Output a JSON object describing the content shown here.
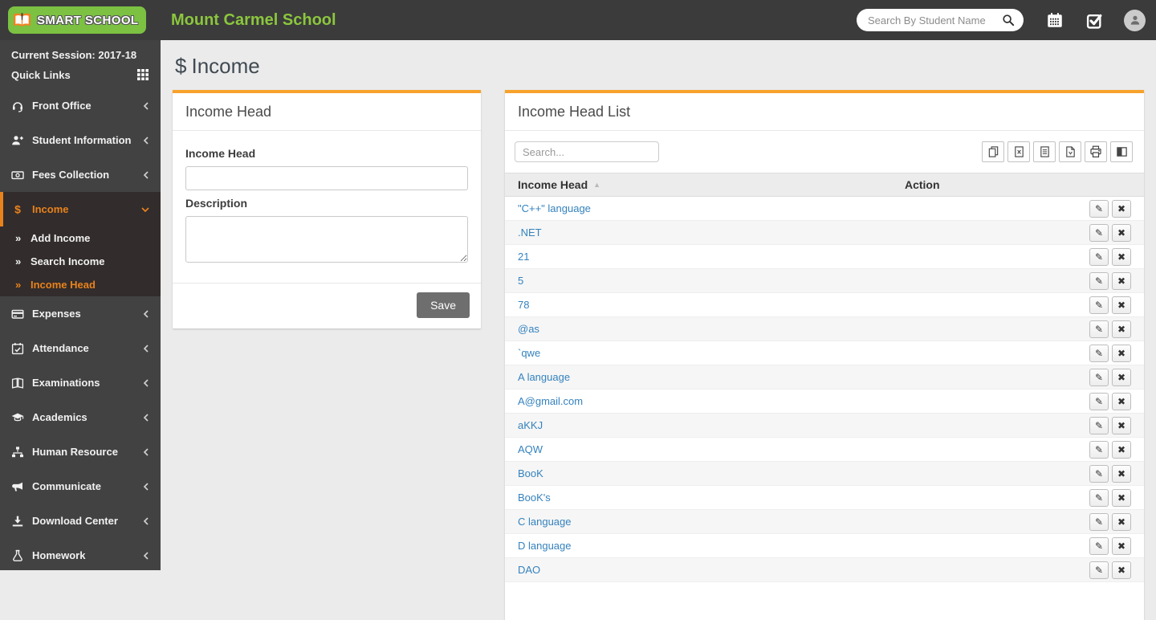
{
  "header": {
    "logo_text": "SMART SCHOOL",
    "school_name": "Mount Carmel School",
    "search_placeholder": "Search By Student Name"
  },
  "sidebar": {
    "session_label": "Current Session: 2017-18",
    "quick_links_label": "Quick Links",
    "items": [
      {
        "label": "Front Office",
        "icon": "headset-icon"
      },
      {
        "label": "Student Information",
        "icon": "user-plus-icon"
      },
      {
        "label": "Fees Collection",
        "icon": "money-bill-icon"
      },
      {
        "label": "Income",
        "icon": "dollar-icon",
        "active": true,
        "expanded": true,
        "children": [
          "Add Income",
          "Search Income",
          "Income Head"
        ],
        "active_child": "Income Head"
      },
      {
        "label": "Expenses",
        "icon": "credit-card-icon"
      },
      {
        "label": "Attendance",
        "icon": "calendar-check-icon"
      },
      {
        "label": "Examinations",
        "icon": "open-book-icon"
      },
      {
        "label": "Academics",
        "icon": "graduation-cap-icon"
      },
      {
        "label": "Human Resource",
        "icon": "sitemap-icon"
      },
      {
        "label": "Communicate",
        "icon": "bullhorn-icon"
      },
      {
        "label": "Download Center",
        "icon": "download-icon"
      },
      {
        "label": "Homework",
        "icon": "flask-icon"
      }
    ]
  },
  "page": {
    "title_icon": "$",
    "title": "Income"
  },
  "form_card": {
    "title": "Income Head",
    "income_head_label": "Income Head",
    "income_head_value": "",
    "description_label": "Description",
    "description_value": "",
    "save_label": "Save"
  },
  "list_card": {
    "title": "Income Head List",
    "search_placeholder": "Search...",
    "toolbar": [
      "copy",
      "excel",
      "csv",
      "pdf",
      "print",
      "columns"
    ],
    "table": {
      "columns": [
        "Income Head",
        "Action"
      ],
      "sort": {
        "column": "Income Head",
        "direction": "asc"
      },
      "rows": [
        "\"C++\" language",
        ".NET",
        "21",
        "5",
        "78",
        "@as",
        "`qwe",
        "A language",
        "A@gmail.com",
        "aKKJ",
        "AQW",
        "BooK",
        "BooK's",
        "C language",
        "D language",
        "DAO"
      ]
    }
  },
  "icons": {
    "edit_glyph": "✎",
    "delete_glyph": "✖",
    "sort_asc_glyph": "▲",
    "submenu_arrow_glyph": "»"
  },
  "colors": {
    "header_dark": "#3b3b3b",
    "sidebar_dark": "#424242",
    "active_menu_bg": "#322c2c",
    "accent_orange": "#e8821c",
    "card_top_border": "#f7a22a",
    "brand_green": "#8bc63e",
    "link_blue": "#3482be",
    "save_button_gray": "#6e6e6e"
  }
}
